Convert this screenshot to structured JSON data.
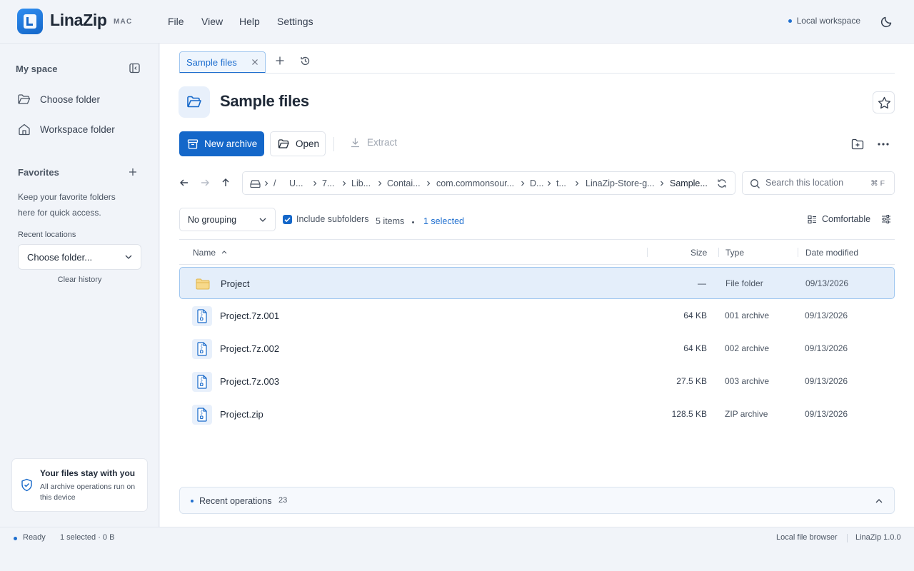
{
  "app": {
    "name": "LinaZip",
    "platform": "MAC",
    "menu": [
      "File",
      "View",
      "Help",
      "Settings"
    ],
    "workspace_label": "Local workspace",
    "accent": "#1467c9"
  },
  "sidebar": {
    "my_space_title": "My space",
    "items": [
      {
        "label": "Choose folder",
        "icon": "folder-open-icon"
      },
      {
        "label": "Workspace folder",
        "icon": "home-icon"
      }
    ],
    "favorites_title": "Favorites",
    "favorites_hint": "Keep your favorite folders here for quick access.",
    "recent_label": "Recent locations",
    "recent_select_value": "Choose folder...",
    "clear_history": "Clear history",
    "privacy_title": "Your files stay with you",
    "privacy_text": "All archive operations run on this device"
  },
  "tabs": [
    {
      "label": "Sample files",
      "active": true
    }
  ],
  "header": {
    "title": "Sample files"
  },
  "toolbar": {
    "new_archive": "New archive",
    "open": "Open",
    "extract": "Extract"
  },
  "breadcrumbs": [
    "/",
    "U...",
    "7...",
    "Lib...",
    "Contai...",
    "com.commonsour...",
    "D...",
    "t...",
    "LinaZip-Store-g...",
    "Sample..."
  ],
  "search": {
    "placeholder": "Search this location",
    "shortcut": "⌘ F"
  },
  "filters": {
    "grouping": "No grouping",
    "include_subfolders": "Include subfolders",
    "items_count": "5 items",
    "selected_count": "1 selected",
    "density": "Comfortable"
  },
  "table": {
    "columns": {
      "name": "Name",
      "size": "Size",
      "type": "Type",
      "date": "Date modified"
    },
    "rows": [
      {
        "name": "Project",
        "size": "—",
        "type": "File folder",
        "date": "09/13/2026",
        "kind": "folder",
        "selected": true
      },
      {
        "name": "Project.7z.001",
        "size": "64 KB",
        "type": "001 archive",
        "date": "09/13/2026",
        "kind": "file",
        "selected": false
      },
      {
        "name": "Project.7z.002",
        "size": "64 KB",
        "type": "002 archive",
        "date": "09/13/2026",
        "kind": "file",
        "selected": false
      },
      {
        "name": "Project.7z.003",
        "size": "27.5 KB",
        "type": "003 archive",
        "date": "09/13/2026",
        "kind": "file",
        "selected": false
      },
      {
        "name": "Project.zip",
        "size": "128.5 KB",
        "type": "ZIP archive",
        "date": "09/13/2026",
        "kind": "file",
        "selected": false
      }
    ]
  },
  "recent_operations": {
    "label": "Recent operations",
    "count": "23"
  },
  "status": {
    "state": "Ready",
    "selection": "1 selected · 0 B",
    "mode": "Local file browser",
    "version": "LinaZip 1.0.0"
  }
}
